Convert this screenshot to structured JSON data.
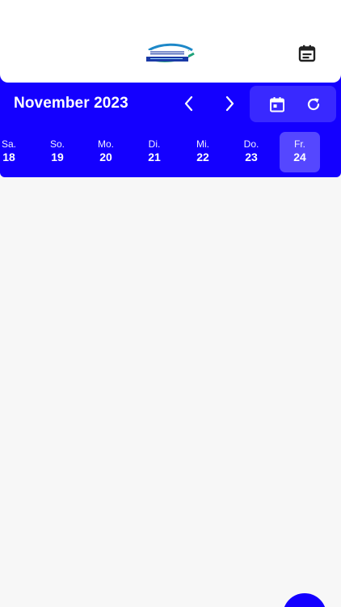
{
  "header": {
    "logo_text": "OSTELAND",
    "logo_subtext": "PHYSIOTHERAPIE"
  },
  "calendar": {
    "month_title": "November 2023",
    "days": [
      {
        "name": "Sa.",
        "num": "18"
      },
      {
        "name": "So.",
        "num": "19"
      },
      {
        "name": "Mo.",
        "num": "20"
      },
      {
        "name": "Di.",
        "num": "21"
      },
      {
        "name": "Mi.",
        "num": "22"
      },
      {
        "name": "Do.",
        "num": "23"
      },
      {
        "name": "Fr.",
        "num": "24"
      }
    ],
    "selected_day": "24"
  },
  "colors": {
    "primary": "#1400ff",
    "background": "#f7f7f7",
    "header_bg": "#ffffff",
    "icon_dark": "#222222"
  },
  "icons": {
    "topbar": "calendar-list-icon",
    "prev": "chevron-left-icon",
    "next": "chevron-right-icon",
    "jump": "calendar-icon",
    "refresh": "refresh-icon"
  }
}
